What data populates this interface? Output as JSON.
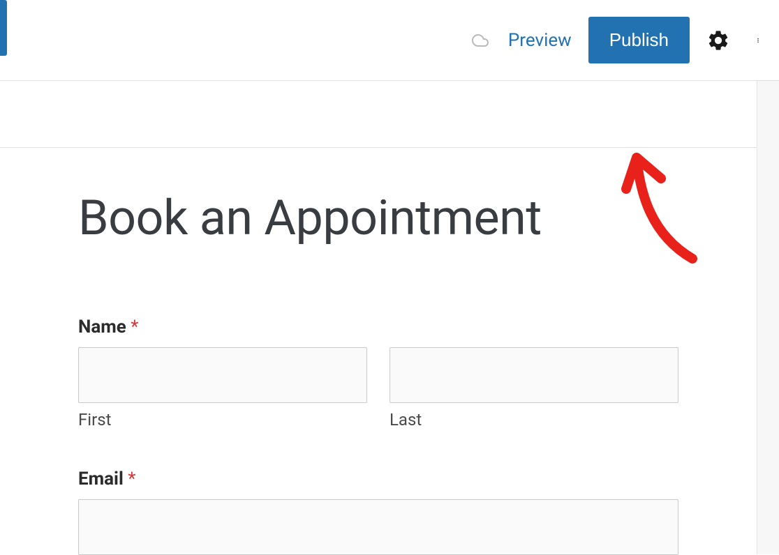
{
  "topbar": {
    "preview_label": "Preview",
    "publish_label": "Publish"
  },
  "page": {
    "title": "Book an Appointment"
  },
  "form": {
    "name": {
      "label": "Name",
      "required_marker": "*",
      "first_sublabel": "First",
      "last_sublabel": "Last"
    },
    "email": {
      "label": "Email",
      "required_marker": "*"
    }
  },
  "icons": {
    "cloud": "cloud-icon",
    "gear": "gear-icon",
    "more": "more-icon"
  }
}
